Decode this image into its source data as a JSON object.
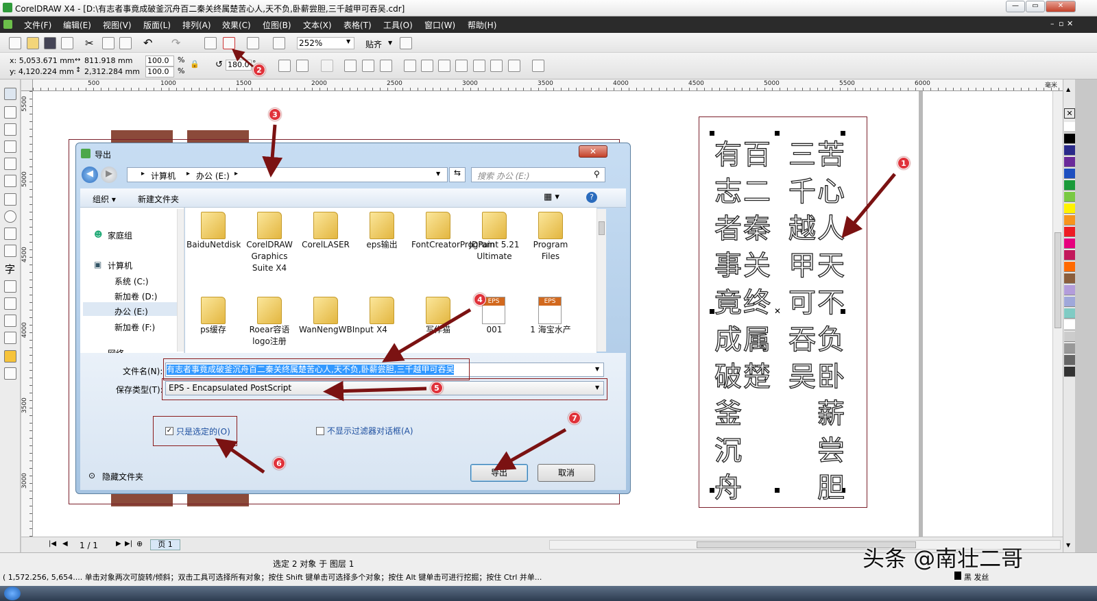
{
  "window": {
    "title": "CorelDRAW X4 - [D:\\有志者事竟成破釜沉舟百二秦关终属楚苦心人,天不负,卧薪尝胆,三千越甲可吞吴.cdr]",
    "minimize": "—",
    "restore": "▭",
    "close": "✕"
  },
  "menu": [
    "文件(F)",
    "编辑(E)",
    "视图(V)",
    "版面(L)",
    "排列(A)",
    "效果(C)",
    "位图(B)",
    "文本(X)",
    "表格(T)",
    "工具(O)",
    "窗口(W)",
    "帮助(H)"
  ],
  "toolbar": {
    "zoom": "252%",
    "snap": "贴齐"
  },
  "property_bar": {
    "x": "x: 5,053.671 mm",
    "y": "y: 4,120.224 mm",
    "w": "811.918 mm",
    "h": "2,312.284 mm",
    "scale_x": "100.0",
    "scale_y": "100.0",
    "pct1": "%",
    "pct2": "%",
    "rotation": "180.0",
    "rot_unit": "°"
  },
  "rulers": {
    "h_labels": [
      "500",
      "1000",
      "1500",
      "2000",
      "2500",
      "3000",
      "3500",
      "4000",
      "4500",
      "5000",
      "5500",
      "6000"
    ],
    "h_unit": "毫米",
    "v_labels": [
      "5500",
      "5000",
      "4500",
      "4000",
      "3500",
      "3000"
    ]
  },
  "artwork": {
    "col_left_a": [
      "有",
      "志",
      "者",
      "事",
      "竟",
      "成",
      "破",
      "釜",
      "沉",
      "舟"
    ],
    "col_left_b": [
      "百",
      "二",
      "秦",
      "关",
      "终",
      "属",
      "楚"
    ],
    "col_right_a": [
      "三",
      "千",
      "越",
      "甲",
      "可",
      "吞",
      "吴"
    ],
    "col_right_b": [
      "苦",
      "心",
      "人",
      "天",
      "不",
      "负",
      "卧",
      "薪",
      "尝",
      "胆"
    ]
  },
  "dialog": {
    "title": "导出",
    "breadcrumb": [
      "计算机",
      "办公 (E:)"
    ],
    "search_placeholder": "搜索 办公 (E:)",
    "organize": "组织 ▾",
    "new_folder": "新建文件夹",
    "nav": [
      "家庭组",
      "计算机",
      "系统 (C:)",
      "新加卷 (D:)",
      "办公 (E:)",
      "新加卷 (F:)",
      "网络"
    ],
    "files": [
      "BaiduNetdisk",
      "CorelDRAW Graphics Suite X4",
      "CorelLASER",
      "eps输出",
      "FontCreatorProgram",
      "JDPaint 5.21 Ultimate",
      "Program Files",
      "ps缓存",
      "Roear容语logo注册",
      "WanNengWBInput",
      "X4",
      "写作猫",
      "001",
      "1 海宝水产"
    ],
    "eps_badge": "EPS",
    "filename_label": "文件名(N):",
    "filename": "有志者事竟成破釜沉舟百二秦关终属楚苦心人,天不负,卧薪尝胆,三千越甲可吞吴",
    "savetype_label": "保存类型(T):",
    "savetype": "EPS - Encapsulated PostScript",
    "only_selected": "只是选定的(O)",
    "no_filter": "不显示过滤器对话框(A)",
    "hide_folders": "隐藏文件夹",
    "export": "导出",
    "cancel": "取消"
  },
  "markers": [
    "1",
    "2",
    "3",
    "4",
    "5",
    "6",
    "7"
  ],
  "pagenav": {
    "count": "1 / 1",
    "tab": "页 1"
  },
  "status": {
    "selection": "选定 2 对象 于 图层 1",
    "hint": "( 1,572.256, 5,654.... 单击对象两次可旋转/倾斜；双击工具可选择所有对象；按住 Shift 键单击可选择多个对象；按住 Alt 键单击可进行挖掘；按住 Ctrl 并单...",
    "outline": "黑 发丝"
  },
  "watermark": "头条 @南壮二哥",
  "colors": {
    "accent_arrow": "#7b1212",
    "marker": "#e0323a",
    "highlight": "#3399ff",
    "menubar": "#2b2b2b",
    "palette": [
      "#ffffff",
      "#000000",
      "#2a2a8a",
      "#6a2a9a",
      "#1e4fbf",
      "#1a9a3a",
      "#7ac943",
      "#fff200",
      "#f7941d",
      "#ed1c24",
      "#e6007e",
      "#c2185b",
      "#ff6a00",
      "#8b5e3c",
      "#b39ddb",
      "#9fa8da",
      "#80cbc4",
      "#ffffff",
      "#cccccc",
      "#999999",
      "#666666",
      "#333333"
    ]
  }
}
